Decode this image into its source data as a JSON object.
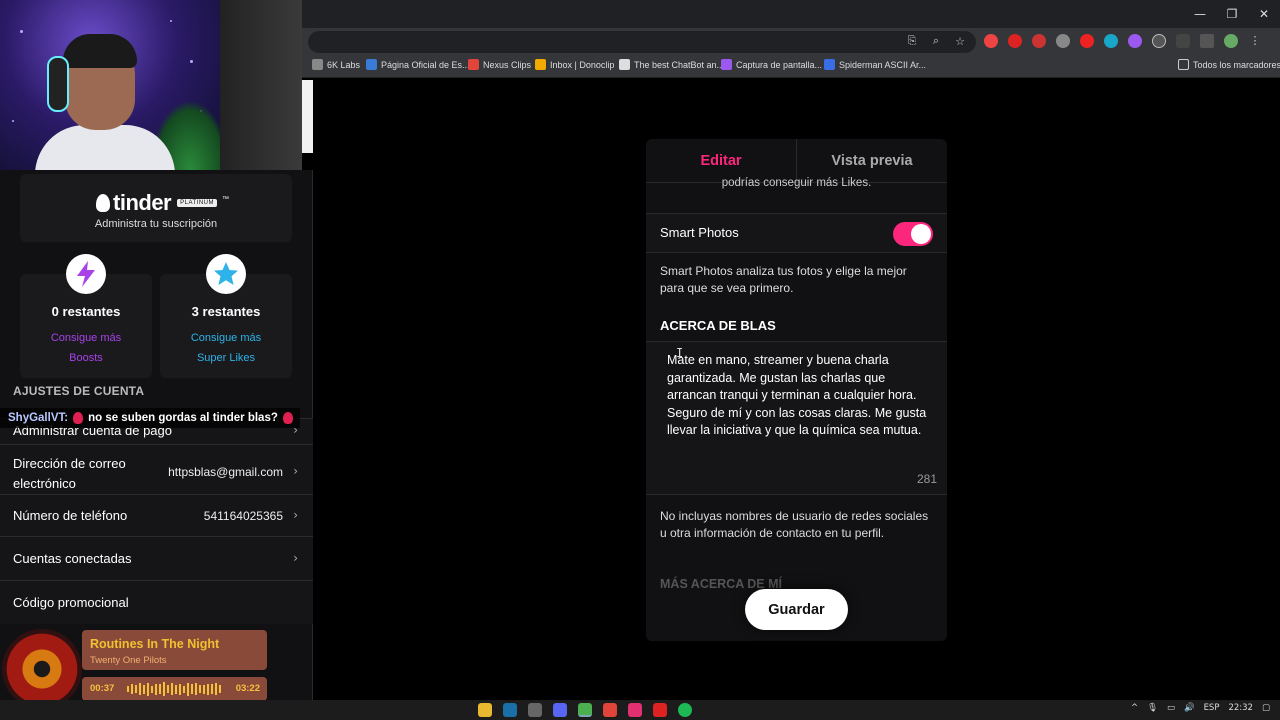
{
  "browser": {
    "window_controls": [
      "—",
      "❐",
      "✕"
    ],
    "bookmarks": [
      {
        "label": "6K Labs",
        "color": "#888888"
      },
      {
        "label": "Página Oficial de Es...",
        "color": "#3a7bd5"
      },
      {
        "label": "Nexus Clips",
        "color": "#e0443a"
      },
      {
        "label": "Inbox | Donoclip",
        "color": "#f2a900"
      },
      {
        "label": "The best ChatBot an...",
        "color": "#dddddd"
      },
      {
        "label": "Captura de pantalla...",
        "color": "#9b59f0"
      },
      {
        "label": "Spiderman ASCII Ar...",
        "color": "#3a6ee8"
      },
      {
        "label": "Todos los marcadores",
        "color": "#cccccc"
      }
    ]
  },
  "sidebar": {
    "tinder_brand": "tinder",
    "tinder_tier": "PLATINUM",
    "tinder_tm": "™",
    "manage_subscription": "Administra tu suscripción",
    "boosts": {
      "remaining": "0 restantes",
      "cta_line1": "Consigue más",
      "cta_line2": "Boosts",
      "color": "#a742e8"
    },
    "super_likes": {
      "remaining": "3 restantes",
      "cta_line1": "Consigue más",
      "cta_line2": "Super Likes",
      "color": "#2db3e8"
    },
    "account_section_title": "AJUSTES DE CUENTA",
    "rows": [
      {
        "label": "Administrar cuenta de pago",
        "value": ""
      },
      {
        "label": "Dirección de correo electrónico",
        "value": "httpsblas@gmail.com"
      },
      {
        "label": "Número de teléfono",
        "value": "541164025365"
      },
      {
        "label": "Cuentas conectadas",
        "value": ""
      },
      {
        "label": "Código promocional",
        "value": ""
      }
    ]
  },
  "chat": {
    "user": "ShyGallVT:",
    "message": "no se suben gordas al tinder blas?"
  },
  "music": {
    "title": "Routines In The Night",
    "artist": "Twenty One Pilots",
    "elapsed": "00:37",
    "duration": "03:22",
    "progress": 0.18
  },
  "editor": {
    "tab_edit": "Editar",
    "tab_preview": "Vista previa",
    "active_color": "#fd267d",
    "cut_text": "podrías conseguir más Likes.",
    "smart_photos_label": "Smart Photos",
    "smart_photos_on": true,
    "smart_photos_desc": "Smart Photos analiza tus fotos y elige la mejor para que se vea primero.",
    "about_title": "ACERCA DE BLAS",
    "about_text": "Mate en mano, streamer  y buena charla garantizada. Me gustan las charlas que arrancan tranqui y terminan a cualquier hora. Seguro de mí y con las cosas claras. Me gusta llevar la iniciativa y que la química sea mutua.",
    "char_count": "281",
    "note": "No incluyas nombres de usuario de redes sociales u otra información de contacto en tu perfil.",
    "more_about_title": "MÁS ACERCA DE MÍ",
    "save_label": "Guardar"
  },
  "taskbar": {
    "language": "ESP",
    "time": "22:32"
  }
}
